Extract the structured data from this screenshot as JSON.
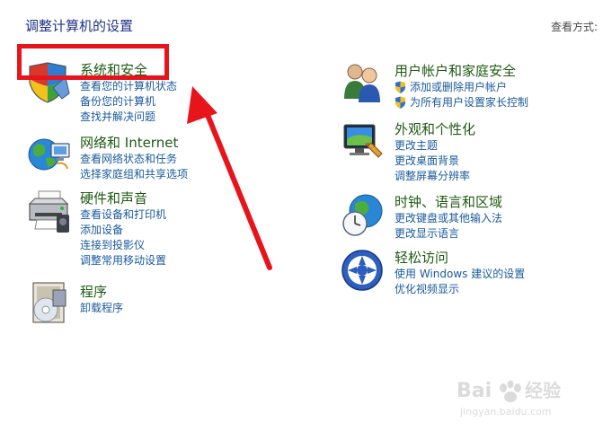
{
  "header": {
    "title": "调整计算机的设置",
    "view_by_label": "查看方式:"
  },
  "categories": [
    {
      "title": "系统和安全",
      "icon": "shield-security-icon",
      "links": [
        {
          "label": "查看您的计算机状态"
        },
        {
          "label": "备份您的计算机"
        },
        {
          "label": "查找并解决问题"
        }
      ]
    },
    {
      "title": "网络和 Internet",
      "icon": "network-globe-icon",
      "links": [
        {
          "label": "查看网络状态和任务"
        },
        {
          "label": "选择家庭组和共享选项"
        }
      ]
    },
    {
      "title": "硬件和声音",
      "icon": "printer-icon",
      "links": [
        {
          "label": "查看设备和打印机"
        },
        {
          "label": "添加设备"
        },
        {
          "label": "连接到投影仪"
        },
        {
          "label": "调整常用移动设置"
        }
      ]
    },
    {
      "title": "程序",
      "icon": "programs-icon",
      "links": [
        {
          "label": "卸载程序"
        }
      ]
    },
    {
      "title": "用户帐户和家庭安全",
      "icon": "users-icon",
      "links": [
        {
          "label": "添加或删除用户帐户",
          "shield": true
        },
        {
          "label": "为所有用户设置家长控制",
          "shield": true
        }
      ]
    },
    {
      "title": "外观和个性化",
      "icon": "display-icon",
      "links": [
        {
          "label": "更改主题"
        },
        {
          "label": "更改桌面背景"
        },
        {
          "label": "调整屏幕分辨率"
        }
      ]
    },
    {
      "title": "时钟、语言和区域",
      "icon": "clock-globe-icon",
      "links": [
        {
          "label": "更改键盘或其他输入法"
        },
        {
          "label": "更改显示语言"
        }
      ]
    },
    {
      "title": "轻松访问",
      "icon": "ease-of-access-icon",
      "links": [
        {
          "label": "使用 Windows 建议的设置"
        },
        {
          "label": "优化视频显示"
        }
      ]
    }
  ],
  "annotation": {
    "highlight_color": "#e8141b",
    "arrow_color": "#e8141b"
  },
  "watermark": {
    "brand_text": "Bai经验",
    "url_text": "jingyan.baidu.com"
  }
}
